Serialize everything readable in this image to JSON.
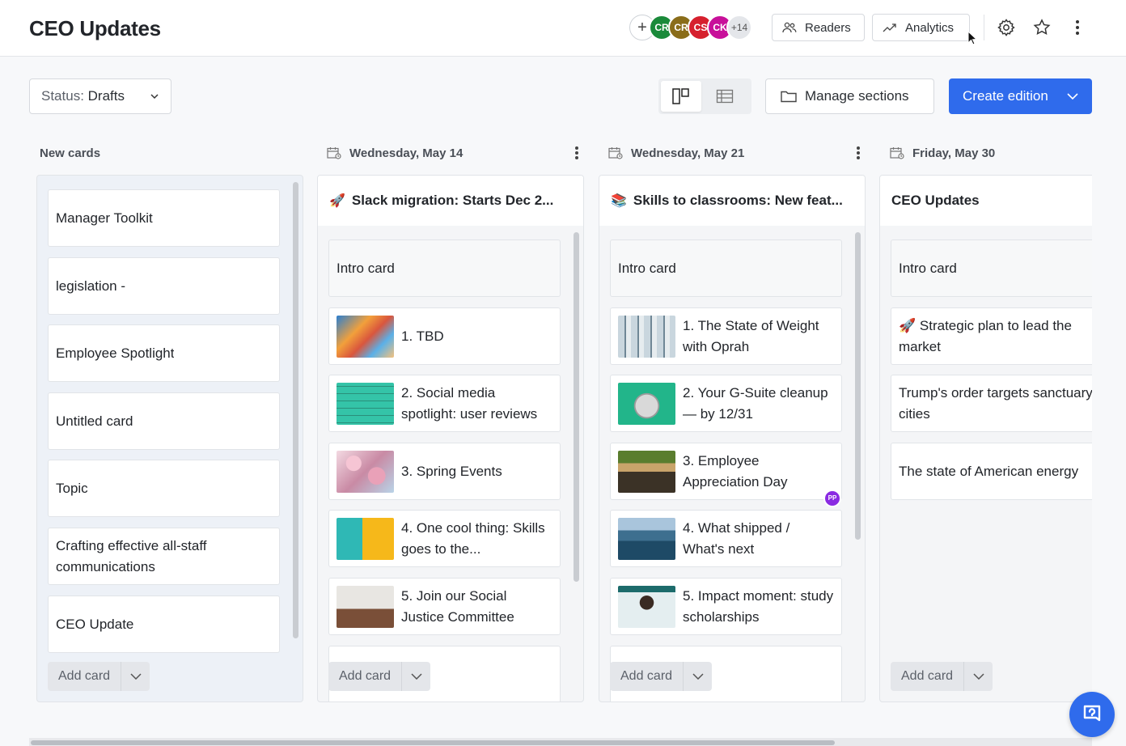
{
  "header": {
    "title": "CEO Updates",
    "avatars": [
      {
        "initials": "CR",
        "color": "#1a8a3a"
      },
      {
        "initials": "CR",
        "color": "#8a6d1a"
      },
      {
        "initials": "CS",
        "color": "#d6202e"
      },
      {
        "initials": "CK",
        "color": "#c8109a"
      }
    ],
    "more_count": "+14",
    "readers_label": "Readers",
    "analytics_label": "Analytics"
  },
  "toolbar": {
    "status_key": "Status:",
    "status_value": "Drafts",
    "manage_label": "Manage sections",
    "create_label": "Create edition",
    "accent": "#2f6bec"
  },
  "columns": [
    {
      "header": "New cards",
      "cards": [
        {
          "title": "Manager Toolkit"
        },
        {
          "title": "legislation -"
        },
        {
          "title": "Employee Spotlight"
        },
        {
          "title": "Untitled card"
        },
        {
          "title": "Topic"
        },
        {
          "title": "Crafting effective all-staff communications"
        },
        {
          "title": "CEO Update"
        }
      ],
      "add_label": "Add card"
    },
    {
      "header": "Wednesday, May 14",
      "edition_emoji": "🚀",
      "edition_title": "Slack migration: Starts Dec 2...",
      "cards": [
        {
          "title": "Intro card"
        },
        {
          "title": "1. TBD",
          "thumb": "hands"
        },
        {
          "title": "2. Social media spotlight: user reviews",
          "thumb": "teal-doc"
        },
        {
          "title": "3. Spring Events",
          "thumb": "blossom"
        },
        {
          "title": "4. One cool thing: Skills goes to the...",
          "thumb": "school"
        },
        {
          "title": "5. Join our Social Justice Committee",
          "thumb": "scales"
        }
      ],
      "add_label": "Add card"
    },
    {
      "header": "Wednesday, May 21",
      "edition_emoji": "📚",
      "edition_title": "Skills to classrooms: New feat...",
      "cards": [
        {
          "title": "Intro card"
        },
        {
          "title": "1. The State of Weight with Oprah",
          "thumb": "office"
        },
        {
          "title": "2. Your G-Suite cleanup — by 12/31",
          "thumb": "coin"
        },
        {
          "title": "3. Employee Appreciation Day",
          "thumb": "thankyou",
          "badge": "PP"
        },
        {
          "title": "4. What shipped / What's next",
          "thumb": "ship"
        },
        {
          "title": "5. Impact moment: study scholarships",
          "thumb": "poster"
        }
      ],
      "add_label": "Add card"
    },
    {
      "header": "Friday, May 30",
      "edition_emoji": "",
      "edition_title": "CEO Updates",
      "cards": [
        {
          "title": "Intro card"
        },
        {
          "title": "🚀 Strategic plan to lead the market"
        },
        {
          "title": "Trump's order targets sanctuary cities"
        },
        {
          "title": "The state of American energy"
        }
      ],
      "add_label": "Add card"
    }
  ]
}
